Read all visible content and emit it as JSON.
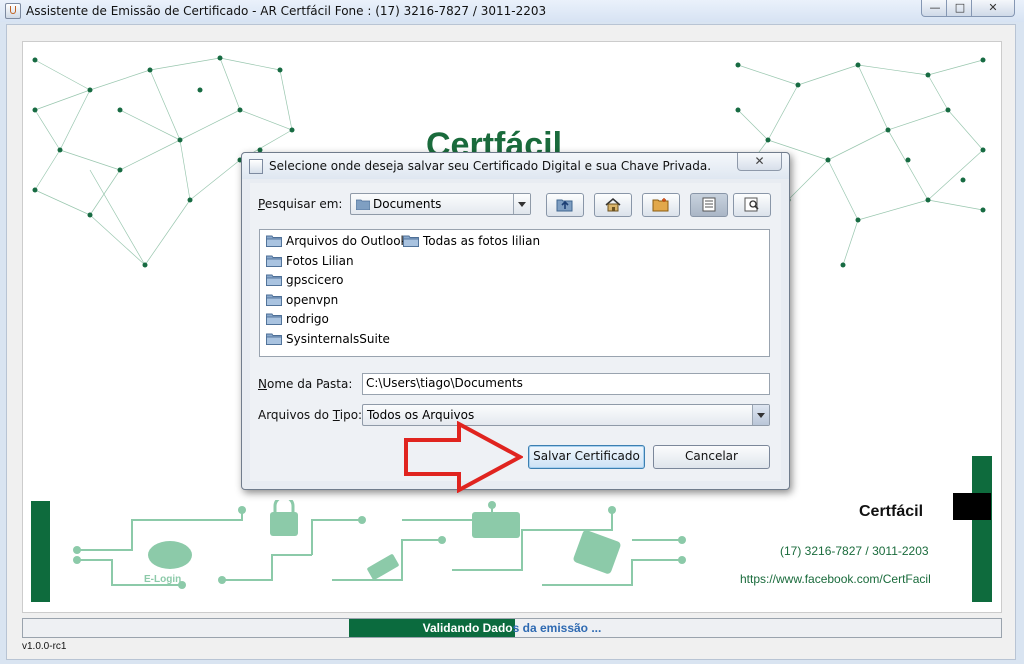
{
  "window": {
    "title": "Assistente de Emissão de Certificado - AR Certfácil Fone : (17) 3216-7827 / 3011-2203",
    "controls": {
      "minimize": "—",
      "maximize": "□",
      "close": "✕"
    }
  },
  "branding": {
    "logo_text": "Certfácil",
    "name": "Certfácil",
    "phone": "(17) 3216-7827 / 3011-2203",
    "facebook": "https://www.facebook.com/CertFacil",
    "colors": {
      "primary_green": "#0e6b3d",
      "accent_blue": "#2e6ab2"
    }
  },
  "dialog": {
    "title": "Selecione onde deseja salvar seu Certificado Digital e sua Chave Privada.",
    "close_label": "✕",
    "look_in": {
      "label_prefix": "P",
      "label_rest": "esquisar em:",
      "value": "Documents"
    },
    "toolbar": [
      {
        "name": "up-one-level-icon"
      },
      {
        "name": "home-icon"
      },
      {
        "name": "new-folder-icon"
      },
      {
        "name": "list-view-icon",
        "active": true
      },
      {
        "name": "details-view-icon"
      }
    ],
    "files": {
      "col1": [
        "Arquivos do Outlook",
        "Fotos Lilian",
        "gpscicero",
        "openvpn",
        "rodrigo",
        "SysinternalsSuite"
      ],
      "col2": [
        "Todas as fotos lilian"
      ]
    },
    "folder_name": {
      "label_prefix": "N",
      "label_rest": "ome da Pasta:",
      "value": "C:\\Users\\tiago\\Documents"
    },
    "file_type": {
      "label_prefix": "Arquivos do ",
      "label_underline": "T",
      "label_rest": "ipo:",
      "value": "Todos os Arquivos"
    },
    "save_button": "Salvar Certificado",
    "cancel_button": "Cancelar"
  },
  "status": {
    "text_on_fill": "Validando Dado",
    "text_rest": "s da emissão ...",
    "progress": 0.17
  },
  "version": "v1.0.0-rc1"
}
